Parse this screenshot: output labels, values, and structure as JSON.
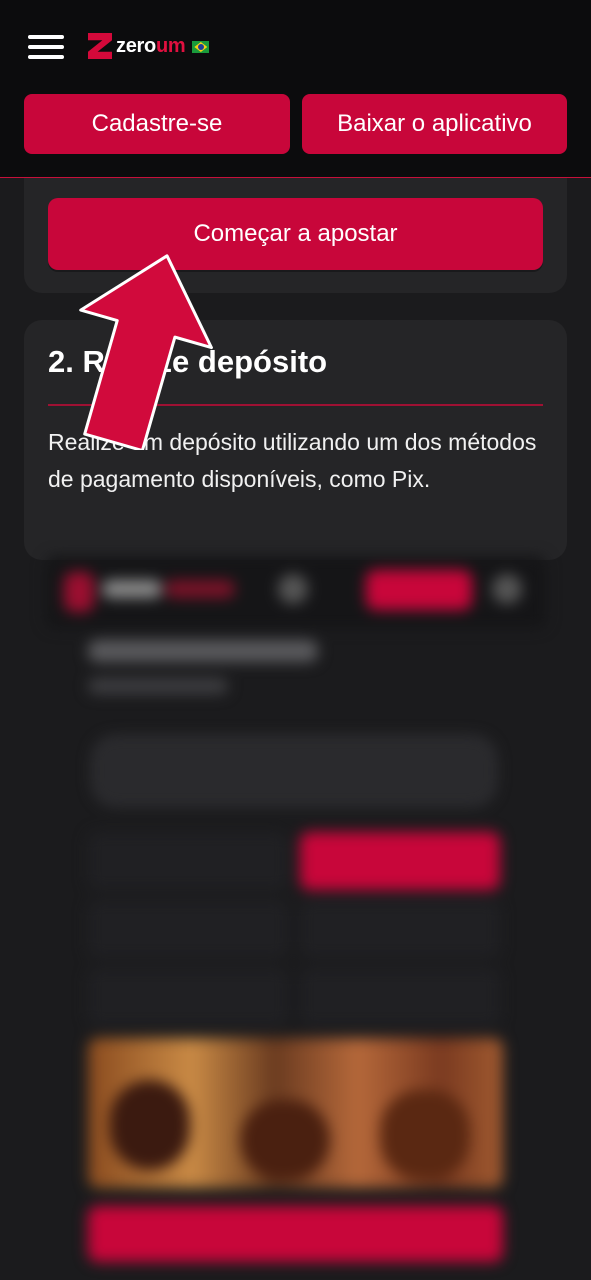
{
  "header": {
    "logo_part1": "zero",
    "logo_part2": "um",
    "signup_label": "Cadastre-se",
    "download_label": "Baixar o aplicativo"
  },
  "step1": {
    "start_label": "Começar a apostar"
  },
  "step2": {
    "title": "2. Realize depósito",
    "description": "Realize um depósito utilizando um dos métodos de pagamento disponíveis, como Pix."
  },
  "colors": {
    "accent": "#c8063a",
    "background": "#1b1b1d",
    "card": "#252527",
    "header": "#0c0c0d"
  },
  "icons": [
    "menu-icon",
    "zeroum-logo",
    "brazil-flag-icon",
    "arrow-pointer-icon"
  ]
}
